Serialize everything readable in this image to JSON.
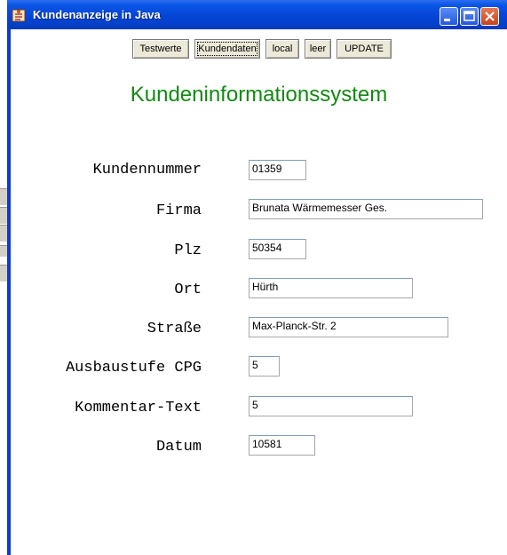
{
  "window": {
    "title": "Kundenanzeige in Java"
  },
  "toolbar": {
    "buttons": [
      "Testwerte",
      "Kundendaten",
      "local",
      "leer",
      "UPDATE"
    ]
  },
  "heading": "Kundeninformationssystem",
  "form": {
    "fields": [
      {
        "label": "Kundennummer",
        "value": "01359"
      },
      {
        "label": "Firma",
        "value": "Brunata Wärmemesser Ges."
      },
      {
        "label": "Plz",
        "value": "50354"
      },
      {
        "label": "Ort",
        "value": "Hürth"
      },
      {
        "label": "Straße",
        "value": "Max-Planck-Str. 2"
      },
      {
        "label": "Ausbaustufe CPG",
        "value": "5"
      },
      {
        "label": "Kommentar-Text",
        "value": "5"
      },
      {
        "label": "Datum",
        "value": "10581"
      }
    ]
  }
}
